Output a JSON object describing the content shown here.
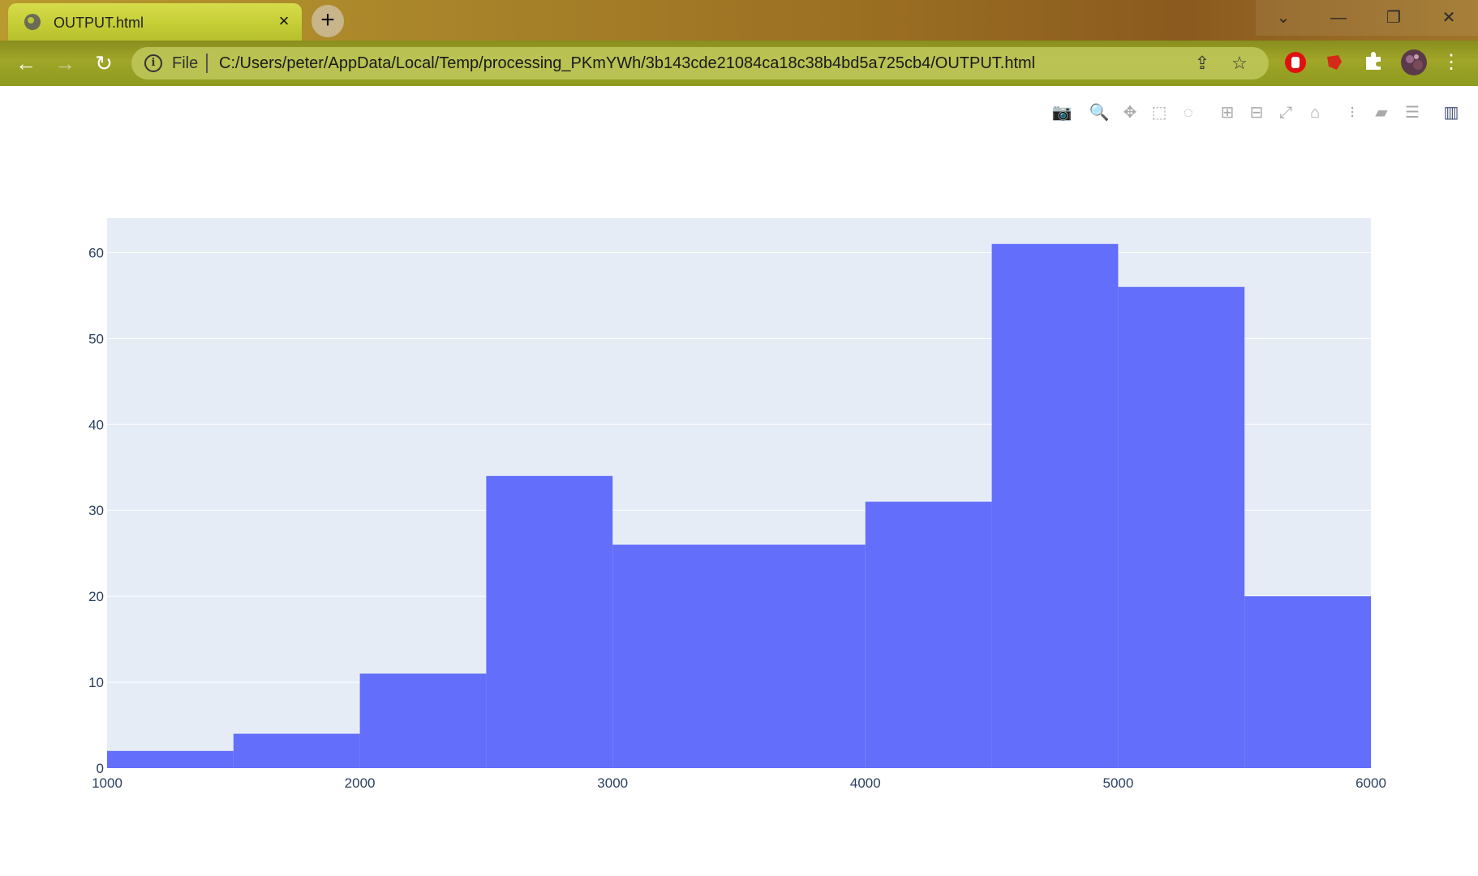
{
  "browser": {
    "tab": {
      "title": "OUTPUT.html",
      "favicon": "globe-icon",
      "close": "×"
    },
    "new_tab": "+",
    "window_controls": {
      "tab_search": "⌄",
      "minimize": "—",
      "restore": "❐",
      "close": "✕"
    },
    "nav": {
      "back": "←",
      "forward": "→",
      "reload": "↻"
    },
    "omnibox": {
      "info_icon": "i",
      "scheme_label": "File",
      "url": "C:/Users/peter/AppData/Local/Temp/processing_PKmYWh/3b143cde21084ca18c38b4bd5a725cb4/OUTPUT.html",
      "share_icon": "share-icon",
      "star_icon": "☆"
    },
    "extensions": [
      "adblock-icon",
      "extension-red-icon",
      "puzzle-icon",
      "profile-avatar",
      "menu-icon"
    ]
  },
  "modebar": {
    "buttons": [
      {
        "name": "camera-icon",
        "glyph": "📷"
      },
      {
        "name": "zoom-icon",
        "glyph": "🔍"
      },
      {
        "name": "pan-icon",
        "glyph": "✥"
      },
      {
        "name": "box-select-icon",
        "glyph": "⬚"
      },
      {
        "name": "lasso-select-icon",
        "glyph": "◌"
      },
      {
        "name": "zoom-in-icon",
        "glyph": "⊞"
      },
      {
        "name": "zoom-out-icon",
        "glyph": "⊟"
      },
      {
        "name": "autoscale-icon",
        "glyph": "⤢"
      },
      {
        "name": "reset-axes-icon",
        "glyph": "⌂"
      },
      {
        "name": "spike-lines-icon",
        "glyph": "⁝"
      },
      {
        "name": "hover-closest-icon",
        "glyph": "▰"
      },
      {
        "name": "hover-compare-icon",
        "glyph": "☰"
      },
      {
        "name": "plotly-logo-icon",
        "glyph": "▥"
      }
    ]
  },
  "chart_data": {
    "type": "bar",
    "subtype": "histogram",
    "title": "",
    "xlabel": "",
    "ylabel": "",
    "bin_edges": [
      1000,
      1500,
      2000,
      2500,
      3000,
      3500,
      4000,
      4500,
      5000,
      5500,
      6000
    ],
    "values": [
      2,
      4,
      11,
      34,
      26,
      26,
      31,
      61,
      56,
      20
    ],
    "xlim": [
      1000,
      6000
    ],
    "ylim": [
      0,
      64
    ],
    "x_ticks": [
      1000,
      2000,
      3000,
      4000,
      5000,
      6000
    ],
    "y_ticks": [
      0,
      10,
      20,
      30,
      40,
      50,
      60
    ],
    "grid": true,
    "colors": {
      "bar": "#636efa",
      "plot_bg": "#e5ecf6",
      "grid": "#ffffff",
      "tick_text": "#2a3f5f"
    }
  }
}
